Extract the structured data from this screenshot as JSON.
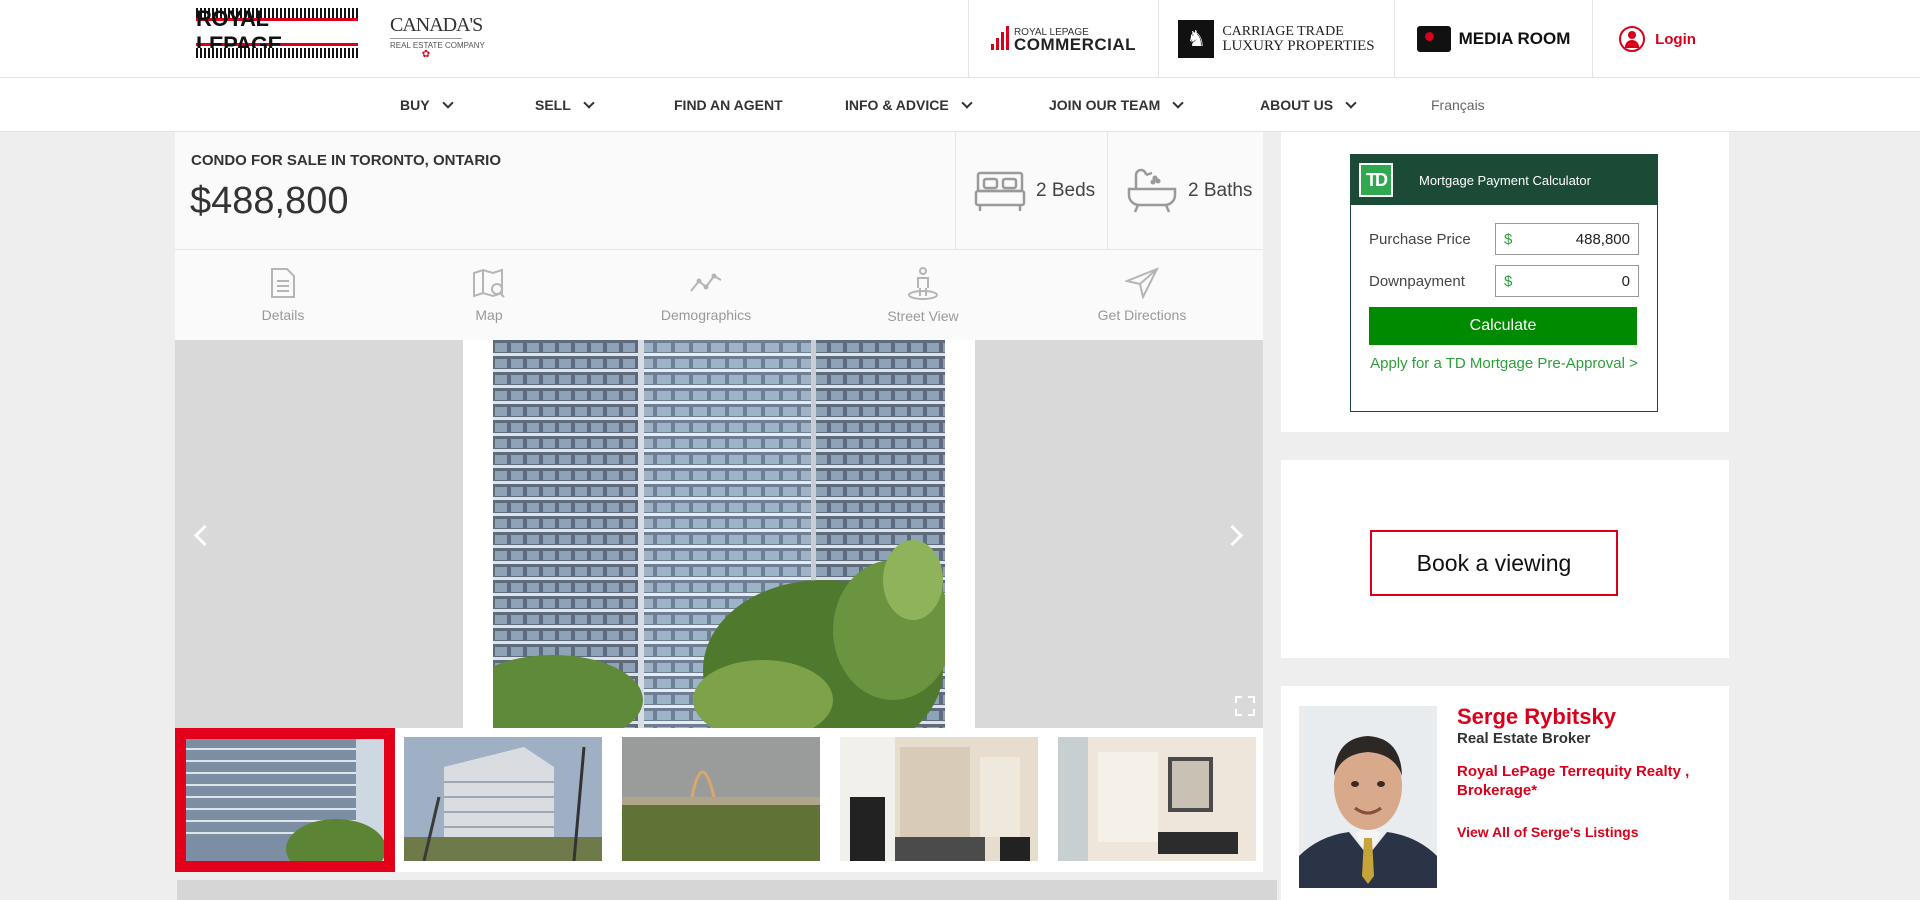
{
  "header": {
    "brand": "ROYAL LEPAGE",
    "tagline_top": "CANADA'S",
    "tagline_bottom": "REAL ESTATE COMPANY",
    "commercial_small": "ROYAL LEPAGE",
    "commercial_big": "COMMERCIAL",
    "luxury_top": "CARRIAGE TRADE",
    "luxury_bottom": "LUXURY PROPERTIES",
    "media_room": "MEDIA ROOM",
    "login": "Login"
  },
  "nav": {
    "items": [
      {
        "label": "BUY"
      },
      {
        "label": "SELL"
      },
      {
        "label": "FIND AN AGENT"
      },
      {
        "label": "INFO & ADVICE"
      },
      {
        "label": "JOIN OUR TEAM"
      },
      {
        "label": "ABOUT US"
      }
    ],
    "language": "Français"
  },
  "listing": {
    "type": "CONDO FOR SALE IN TORONTO, ONTARIO",
    "price": "$488,800",
    "beds": "2 Beds",
    "baths": "2 Baths"
  },
  "tabs": [
    {
      "label": "Details",
      "icon": "document-icon"
    },
    {
      "label": "Map",
      "icon": "map-icon"
    },
    {
      "label": "Demographics",
      "icon": "line-chart-icon"
    },
    {
      "label": "Street View",
      "icon": "street-view-icon"
    },
    {
      "label": "Get Directions",
      "icon": "navigation-icon"
    }
  ],
  "gallery": {
    "thumbnails": [
      "building-front",
      "building-angle",
      "rainbow-view",
      "hallway",
      "entry-mirror"
    ],
    "selected_index": 0
  },
  "calculator": {
    "title": "Mortgage Payment Calculator",
    "logo": "TD",
    "purchase_price_label": "Purchase Price",
    "purchase_price_currency": "$",
    "purchase_price_value": "488,800",
    "downpayment_label": "Downpayment",
    "downpayment_currency": "$",
    "downpayment_value": "0",
    "calculate_label": "Calculate",
    "apply_link": "Apply for a TD Mortgage Pre-Approval >"
  },
  "booking": {
    "label": "Book a viewing"
  },
  "agent": {
    "name": "Serge Rybitsky",
    "title": "Real Estate Broker",
    "brokerage": "Royal LePage Terrequity Realty , Brokerage*",
    "listings_link": "View All of Serge's Listings"
  },
  "colors": {
    "brand_red": "#d9001b",
    "td_green": "#1b4a36",
    "calc_button": "#008a00"
  }
}
